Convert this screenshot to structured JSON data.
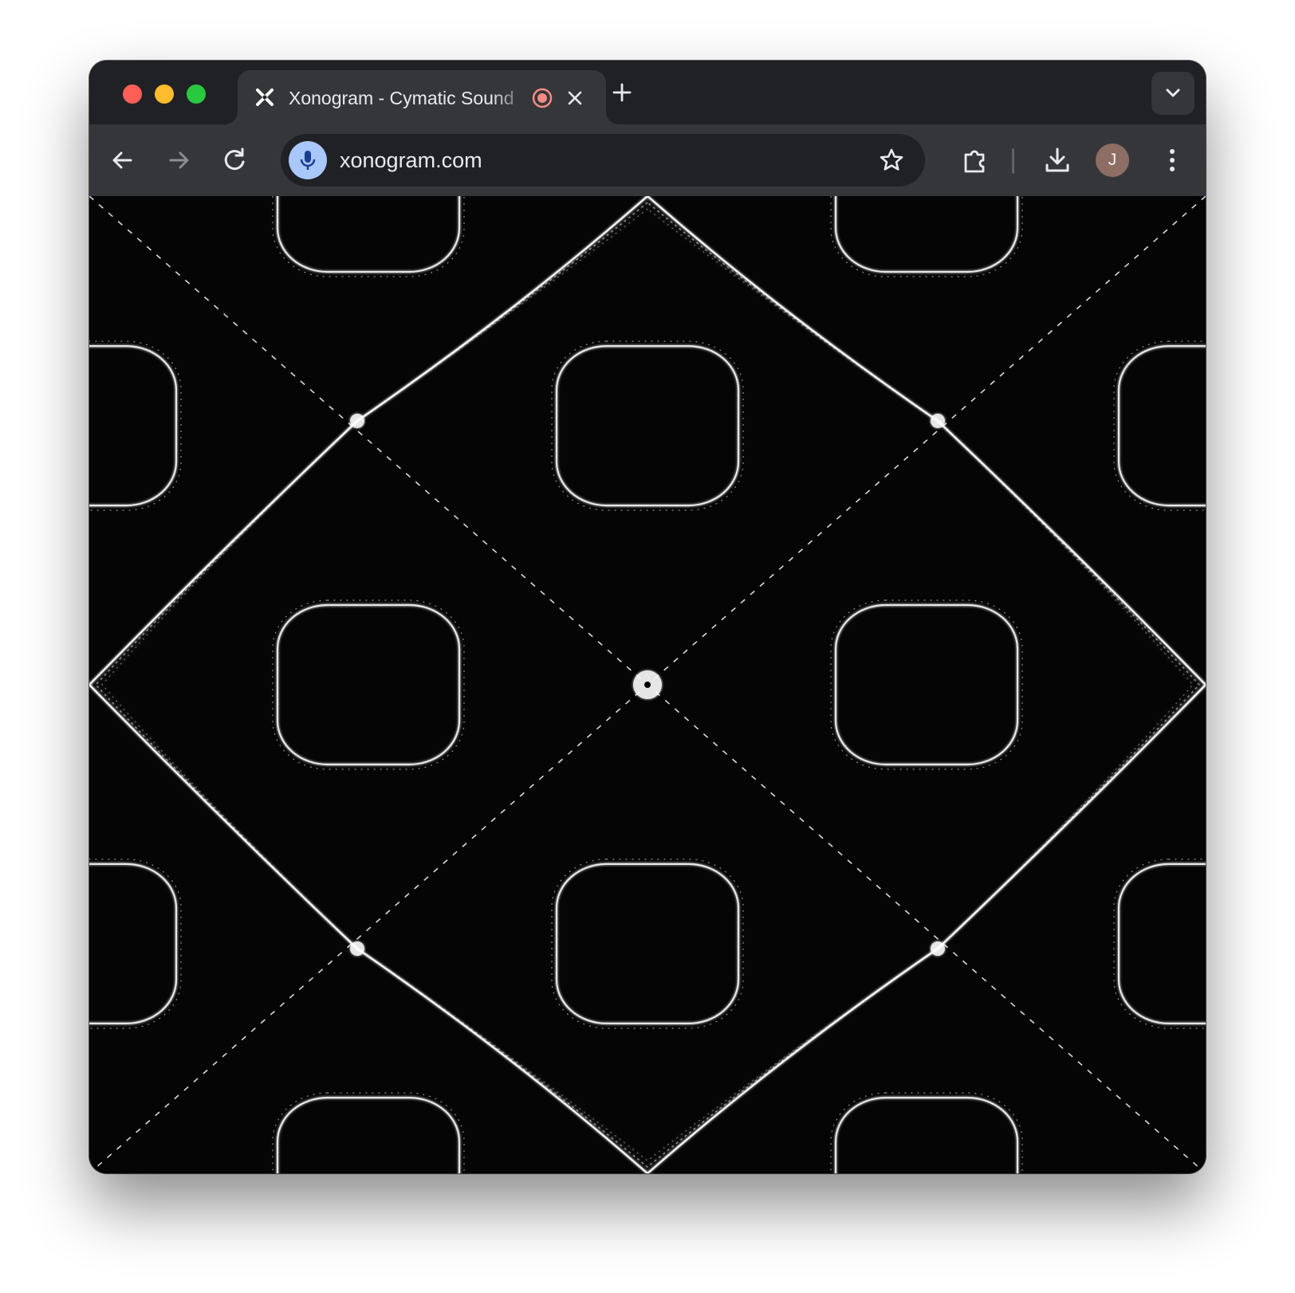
{
  "browser": {
    "tab": {
      "title": "Xonogram - Cymatic Sound",
      "favicon": "xonogram-x-icon",
      "recording_indicator": "recording-icon",
      "close_icon": "close-icon"
    },
    "new_tab_icon": "plus-icon",
    "tab_search_icon": "chevron-down-icon",
    "toolbar": {
      "back_icon": "arrow-left-icon",
      "forward_icon": "arrow-right-icon",
      "reload_icon": "reload-icon",
      "url": "xonogram.com",
      "mic_icon": "microphone-icon",
      "bookmark_icon": "star-icon",
      "extensions_icon": "puzzle-icon",
      "downloads_icon": "download-icon",
      "profile_initial": "J",
      "menu_icon": "kebab-menu-icon"
    },
    "colors": {
      "frame": "#202124",
      "toolbar": "#35363a",
      "omnibox": "#202124",
      "mic_bg": "#a8c7fa",
      "avatar_bg": "#8d6e63",
      "recording": "#f28b82"
    }
  },
  "page": {
    "description_icon": "cymatic-pattern",
    "background": "#050505",
    "pattern_color": "#ffffff"
  }
}
